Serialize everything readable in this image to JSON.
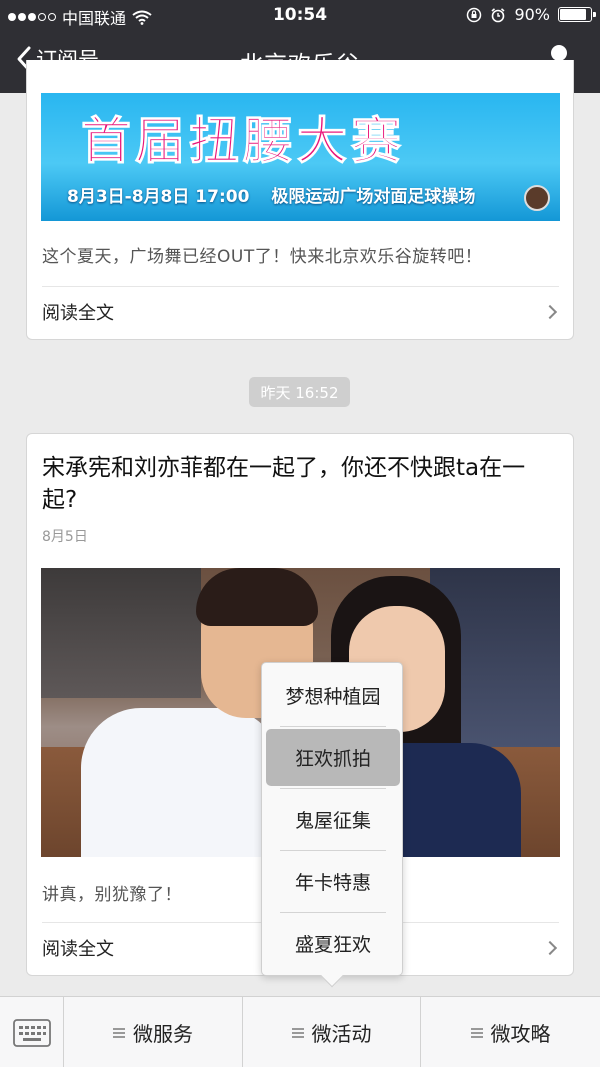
{
  "status_bar": {
    "carrier": "中国联通",
    "time": "10:54",
    "battery": "90%",
    "battery_level": 0.9
  },
  "nav": {
    "back_label": "订阅号",
    "title": "北京欢乐谷"
  },
  "card1": {
    "banner": {
      "headline": "首届扭腰大赛",
      "dates": "8月3日-8月8日 17:00",
      "location": "极限运动广场对面足球操场"
    },
    "description": "这个夏天，广场舞已经OUT了！快来北京欢乐谷旋转吧！",
    "read_more": "阅读全文"
  },
  "time_chip": "昨天 16:52",
  "card2": {
    "headline": "宋承宪和刘亦菲都在一起了，你还不快跟ta在一起?",
    "date": "8月5日",
    "description": "讲真，别犹豫了！",
    "read_more": "阅读全文"
  },
  "popup_menu": {
    "items": [
      "梦想种植园",
      "狂欢抓拍",
      "鬼屋征集",
      "年卡特惠",
      "盛夏狂欢"
    ],
    "selected": "狂欢抓拍"
  },
  "bottom_bar": {
    "tabs": [
      "微服务",
      "微活动",
      "微攻略"
    ]
  },
  "icons": {
    "back": "chevron-left-icon",
    "profile": "person-icon",
    "keyboard": "keyboard-icon",
    "menu": "hamburger-icon"
  }
}
